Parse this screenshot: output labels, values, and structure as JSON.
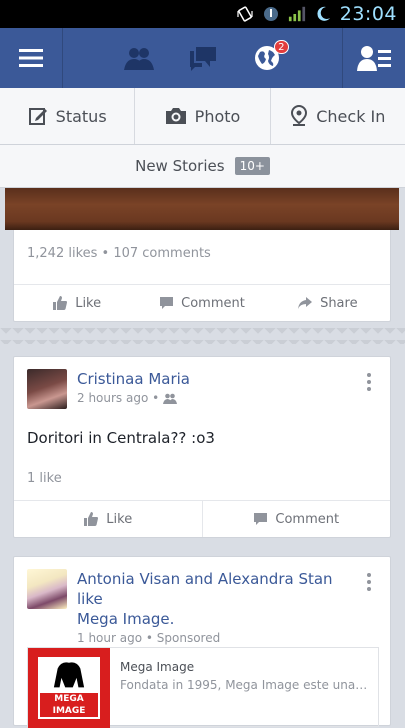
{
  "status_bar": {
    "time": "23:04"
  },
  "topbar": {
    "notification_badge": "2"
  },
  "actions": [
    {
      "label": "Status",
      "icon": "edit-icon"
    },
    {
      "label": "Photo",
      "icon": "camera-icon"
    },
    {
      "label": "Check In",
      "icon": "location-pin-icon"
    }
  ],
  "new_stories": {
    "label": "New Stories",
    "count": "10+"
  },
  "post1": {
    "counts": "1,242 likes • 107 comments",
    "like": "Like",
    "comment": "Comment",
    "share": "Share"
  },
  "post2": {
    "author": "Cristinaa Maria",
    "time": "2 hours ago •",
    "text": "Doritori in Centrala?? :o3",
    "likes": "1 like",
    "like": "Like",
    "comment": "Comment"
  },
  "post3": {
    "headline_part1": "Antonia Visan and Alexandra Stan like",
    "headline_part2": "Mega Image.",
    "time": "1 hour ago • Sponsored",
    "ad_title": "Mega Image",
    "ad_desc": "Fondata in 1995, Mega Image este una…",
    "logo_text": "MEGA IMAGE"
  },
  "colors": {
    "brand": "#3b5998",
    "badge": "#e23d3d",
    "logo_red": "#d81e1e"
  }
}
